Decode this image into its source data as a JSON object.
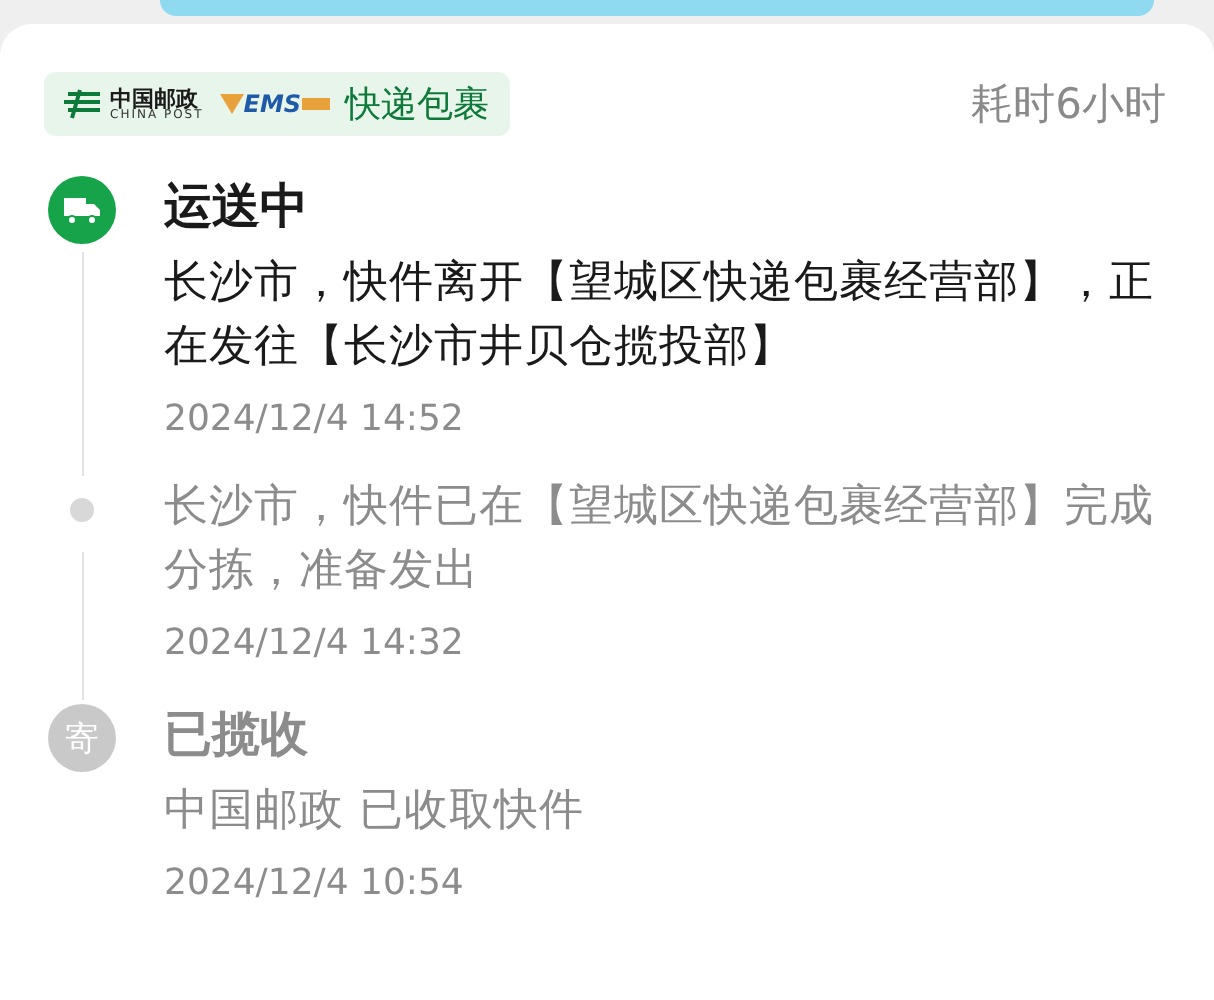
{
  "carrier": {
    "name_cn": "中国邮政",
    "name_en": "CHINA POST",
    "ems": "EMS",
    "service": "快递包裹"
  },
  "duration": "耗时6小时",
  "events": [
    {
      "kind": "truck",
      "status": "运送中",
      "text": "长沙市，快件离开【望城区快递包裹经营部】，正在发往【长沙市井贝仓揽投部】",
      "time": "2024/12/4 14:52",
      "active": true
    },
    {
      "kind": "dot",
      "text": "长沙市，快件已在【望城区快递包裹经营部】完成分拣，准备发出",
      "time": "2024/12/4 14:32",
      "active": false
    },
    {
      "kind": "badge",
      "badge": "寄",
      "status": "已揽收",
      "text": "中国邮政 已收取快件",
      "time": "2024/12/4 10:54",
      "active": false
    }
  ]
}
